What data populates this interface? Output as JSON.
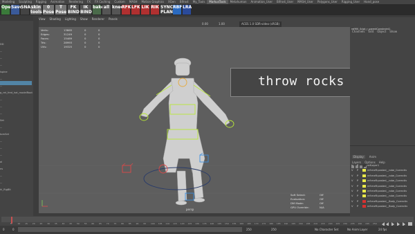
{
  "tabs": [
    "Modeling",
    "Sculpting",
    "Rigging",
    "Animation",
    "Rendering",
    "FX",
    "FX Caching",
    "Custom",
    "MASH",
    "Motion Graphics",
    "XGen",
    "Bifrost",
    "My_Tools",
    "MarkusTools",
    "Metahuman",
    "Animation_User",
    "Bifrost_User",
    "MASH_User",
    "Polygons_User",
    "Rigging_User",
    "Hand_pose"
  ],
  "active_tab": "MarkusTools",
  "shelf": {
    "buttons": [
      {
        "label": "Open"
      },
      {
        "label": "Save"
      },
      {
        "label": "SNAP"
      },
      {
        "label": "skin tools"
      },
      {
        "label": "0 Pose"
      },
      {
        "label": "T Pose"
      },
      {
        "label": "FK BIND"
      },
      {
        "label": "IK BIND"
      },
      {
        "label": "bake"
      },
      {
        "label": "all"
      },
      {
        "label": "knee"
      },
      {
        "label": "RFK"
      },
      {
        "label": "LFK"
      },
      {
        "label": "LIK"
      },
      {
        "label": "RIK"
      },
      {
        "label": "SYNC PLANE"
      },
      {
        "label": "RBF"
      },
      {
        "label": "LRA"
      }
    ]
  },
  "left_panel": {
    "items": [
      "DD",
      "...",
      "...",
      "...",
      "lspine",
      "...",
      "...",
      "g_ret_fred_hat_modelRoot",
      "...",
      "...",
      "...",
      "Set",
      "...",
      "tomSet",
      "...",
      "...",
      "...",
      "al",
      "ns",
      "...",
      "...",
      "hl_RigBlt"
    ]
  },
  "viewport": {
    "menu": [
      "View",
      "Shading",
      "Lighting",
      "Show",
      "Renderer",
      "Panels"
    ],
    "toolbar": {
      "exposure": "0.00",
      "gamma": "1.00",
      "color_space": "ACES 1.0 SDR-video (sRGB)"
    },
    "stats": [
      {
        "label": "Verts:",
        "a": "13865",
        "b": "0",
        "c": "0"
      },
      {
        "label": "Edges:",
        "a": "31249",
        "b": "0",
        "c": "0"
      },
      {
        "label": "Faces:",
        "a": "15469",
        "b": "0",
        "c": "0"
      },
      {
        "label": "Tris:",
        "a": "28993",
        "b": "0",
        "c": "0"
      },
      {
        "label": "UVs:",
        "a": "19325",
        "b": "0",
        "c": "0"
      }
    ],
    "overlay_text": "throw rocks",
    "camera_label": "persp",
    "hud": [
      {
        "label": "Soft Select:",
        "value": "Off"
      },
      {
        "label": "Evaluation:",
        "value": "Off"
      },
      {
        "label": "DM Mode:",
        "value": "Off"
      },
      {
        "label": "GPU Override:",
        "value": "N/A"
      }
    ]
  },
  "right_panel": {
    "tabs": [
      "Channels",
      "Edit",
      "Object",
      "Show"
    ],
    "selected_node": "refHIK_Sclpt_r_parentConstraint1",
    "layer_tabs": [
      "Display",
      "Anim"
    ],
    "layer_menu": [
      "Layers",
      "Options",
      "Help"
    ],
    "layers": [
      {
        "name": "refLayer1",
        "color": "#3a3a3a"
      },
      {
        "name": "ref:meR:pasted__robe_Correctiv",
        "color": "#e8e84a"
      },
      {
        "name": "ref:meR:pasted__robe_Correctiv",
        "color": "#e8e84a"
      },
      {
        "name": "ref:meR:pasted__robe_Correctiv",
        "color": "#e8e84a"
      },
      {
        "name": "ref:meR:pasted__robe_Correctiv",
        "color": "#e8e84a"
      },
      {
        "name": "ref:meR:pasted__robe_Correctiv",
        "color": "#e8e84a"
      },
      {
        "name": "ref:meR:pasted__robe_Correctiv",
        "color": "#e8e84a"
      },
      {
        "name": "ref:meR:pasted__Body_Correctiv",
        "color": "#d83030"
      },
      {
        "name": "ref:meR:pasted__Body_Correctiv",
        "color": "#d83030"
      }
    ]
  },
  "timeline": {
    "ticks": [
      "5",
      "10",
      "15",
      "20",
      "25",
      "30",
      "35",
      "40",
      "45",
      "50",
      "55",
      "60",
      "65",
      "70",
      "75",
      "80",
      "85",
      "90",
      "95",
      "100",
      "105",
      "110",
      "115",
      "120",
      "125",
      "130",
      "135",
      "140",
      "145",
      "150",
      "155",
      "160",
      "165",
      "170",
      "175",
      "180",
      "185",
      "190",
      "195",
      "200",
      "205",
      "210",
      "215",
      "220",
      "225",
      "230",
      "235",
      "240",
      "245",
      "250"
    ],
    "current_frame": "1"
  },
  "range": {
    "start": "0",
    "inner_start": "0",
    "inner_end": "250",
    "end": "250",
    "no_character": "No Character Set",
    "no_anim_layer": "No Anim Layer",
    "fps": "24 fps"
  },
  "colors": {
    "viewport_bg": "#5e5e5e",
    "panel_bg": "#444444",
    "accent_active": "#5285a6"
  }
}
